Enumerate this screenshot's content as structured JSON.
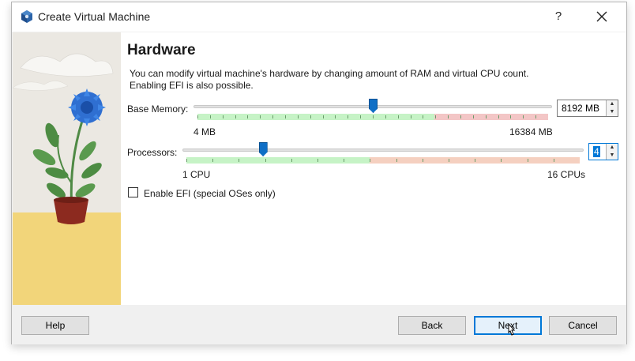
{
  "window": {
    "title": "Create Virtual Machine",
    "help_glyph": "?",
    "title_icon": "virtualbox-cube-icon",
    "close_icon": "close-icon"
  },
  "page": {
    "heading": "Hardware",
    "description_line1": "You can modify virtual machine's hardware by changing amount of RAM and virtual CPU count.",
    "description_line2": "Enabling EFI is also possible."
  },
  "memory": {
    "label": "Base Memory:",
    "value": "8192 MB",
    "min_label": "4 MB",
    "max_label": "16384 MB",
    "level": 0.5
  },
  "processors": {
    "label": "Processors:",
    "value": "4",
    "min_label": "1 CPU",
    "max_label": "16 CPUs",
    "level": 0.2
  },
  "efi": {
    "label": "Enable EFI (special OSes only)",
    "checked": false
  },
  "buttons": {
    "help": "Help",
    "back": "Back",
    "next": "Next",
    "cancel": "Cancel"
  },
  "colors": {
    "accent": "#0f6fc6",
    "ok_green": "#c6f3c6",
    "warn_red": "#f3c6c6",
    "warn_orange": "#f5d0c0"
  }
}
